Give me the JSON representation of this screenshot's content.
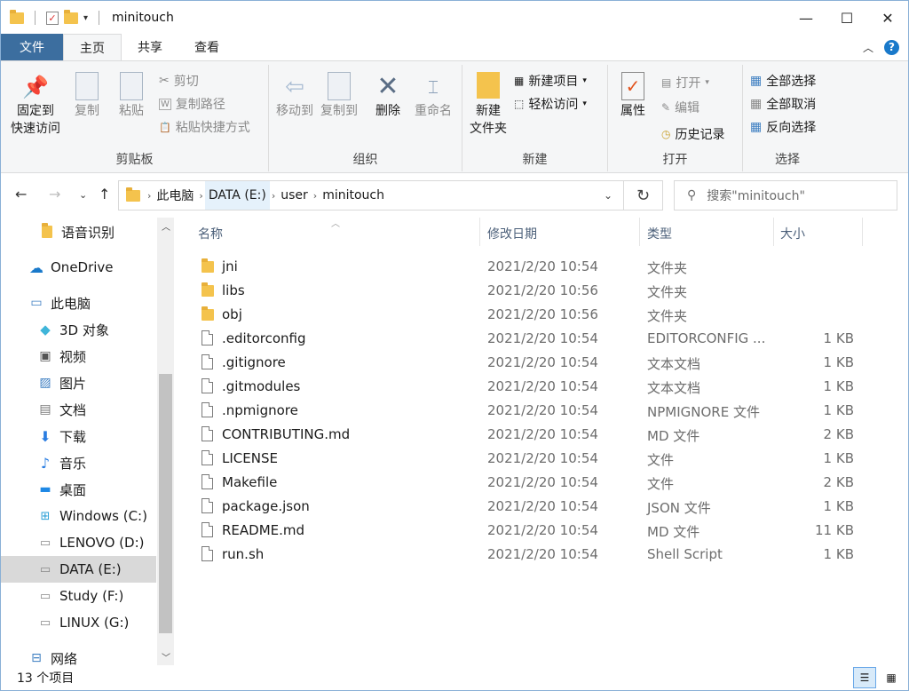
{
  "window": {
    "title": "minitouch",
    "controls": {
      "minimize": "—",
      "maximize": "☐",
      "close": "✕"
    }
  },
  "tabs": {
    "file": "文件",
    "home": "主页",
    "share": "共享",
    "view": "查看"
  },
  "ribbon": {
    "clipboard": {
      "label": "剪贴板",
      "pin": "固定到\n快速访问",
      "pin_l1": "固定到",
      "pin_l2": "快速访问",
      "copy": "复制",
      "paste": "粘贴",
      "cut": "剪切",
      "copy_path": "复制路径",
      "paste_shortcut": "粘贴快捷方式"
    },
    "organize": {
      "label": "组织",
      "move_to": "移动到",
      "copy_to": "复制到",
      "delete": "删除",
      "rename": "重命名"
    },
    "new": {
      "label": "新建",
      "new_folder_l1": "新建",
      "new_folder_l2": "文件夹",
      "new_item": "新建项目",
      "easy_access": "轻松访问"
    },
    "open": {
      "label": "打开",
      "properties": "属性",
      "open": "打开",
      "edit": "编辑",
      "history": "历史记录"
    },
    "select": {
      "label": "选择",
      "select_all": "全部选择",
      "select_none": "全部取消",
      "invert": "反向选择"
    }
  },
  "address": {
    "crumbs": [
      "此电脑",
      "DATA (E:)",
      "user",
      "minitouch"
    ],
    "search_placeholder": "搜索\"minitouch\""
  },
  "nav": {
    "items": [
      {
        "label": "语音识别",
        "icon": "folder-icon"
      },
      {
        "label": "OneDrive",
        "icon": "cloud-icon"
      },
      {
        "label": "此电脑",
        "icon": "computer-icon"
      },
      {
        "label": "3D 对象",
        "icon": "cube-icon"
      },
      {
        "label": "视频",
        "icon": "video-icon"
      },
      {
        "label": "图片",
        "icon": "picture-icon"
      },
      {
        "label": "文档",
        "icon": "document-icon"
      },
      {
        "label": "下载",
        "icon": "download-icon"
      },
      {
        "label": "音乐",
        "icon": "music-icon"
      },
      {
        "label": "桌面",
        "icon": "desktop-icon"
      },
      {
        "label": "Windows (C:)",
        "icon": "windows-drive-icon"
      },
      {
        "label": "LENOVO (D:)",
        "icon": "drive-icon"
      },
      {
        "label": "DATA (E:)",
        "icon": "drive-icon",
        "selected": true
      },
      {
        "label": "Study (F:)",
        "icon": "drive-icon"
      },
      {
        "label": "LINUX (G:)",
        "icon": "drive-icon"
      },
      {
        "label": "网络",
        "icon": "network-icon"
      }
    ]
  },
  "columns": {
    "name": "名称",
    "date": "修改日期",
    "type": "类型",
    "size": "大小"
  },
  "files": [
    {
      "name": "jni",
      "date": "2021/2/20 10:54",
      "type": "文件夹",
      "size": "",
      "kind": "folder"
    },
    {
      "name": "libs",
      "date": "2021/2/20 10:56",
      "type": "文件夹",
      "size": "",
      "kind": "folder"
    },
    {
      "name": "obj",
      "date": "2021/2/20 10:56",
      "type": "文件夹",
      "size": "",
      "kind": "folder"
    },
    {
      "name": ".editorconfig",
      "date": "2021/2/20 10:54",
      "type": "EDITORCONFIG ...",
      "size": "1 KB",
      "kind": "file"
    },
    {
      "name": ".gitignore",
      "date": "2021/2/20 10:54",
      "type": "文本文档",
      "size": "1 KB",
      "kind": "file"
    },
    {
      "name": ".gitmodules",
      "date": "2021/2/20 10:54",
      "type": "文本文档",
      "size": "1 KB",
      "kind": "file"
    },
    {
      "name": ".npmignore",
      "date": "2021/2/20 10:54",
      "type": "NPMIGNORE 文件",
      "size": "1 KB",
      "kind": "file"
    },
    {
      "name": "CONTRIBUTING.md",
      "date": "2021/2/20 10:54",
      "type": "MD 文件",
      "size": "2 KB",
      "kind": "file"
    },
    {
      "name": "LICENSE",
      "date": "2021/2/20 10:54",
      "type": "文件",
      "size": "1 KB",
      "kind": "file"
    },
    {
      "name": "Makefile",
      "date": "2021/2/20 10:54",
      "type": "文件",
      "size": "2 KB",
      "kind": "file"
    },
    {
      "name": "package.json",
      "date": "2021/2/20 10:54",
      "type": "JSON 文件",
      "size": "1 KB",
      "kind": "file"
    },
    {
      "name": "README.md",
      "date": "2021/2/20 10:54",
      "type": "MD 文件",
      "size": "11 KB",
      "kind": "file"
    },
    {
      "name": "run.sh",
      "date": "2021/2/20 10:54",
      "type": "Shell Script",
      "size": "1 KB",
      "kind": "script"
    }
  ],
  "status": {
    "count": "13 个项目"
  },
  "colors": {
    "accent": "#1979ca",
    "file_tab": "#3c6e9f",
    "folder": "#f4c34d",
    "selected_nav": "#d9d9d9"
  }
}
